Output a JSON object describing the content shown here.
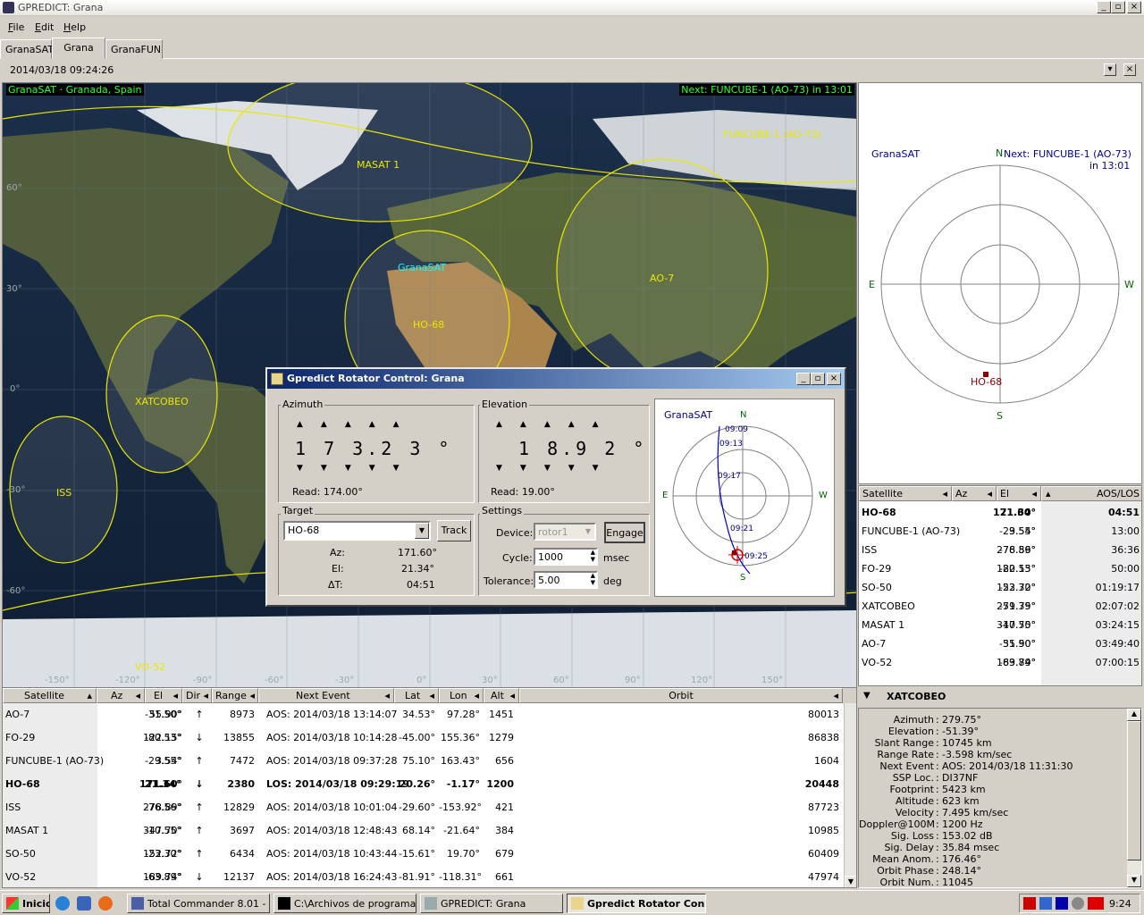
{
  "window": {
    "title": "GPREDICT: Grana"
  },
  "menu": [
    "File",
    "Edit",
    "Help"
  ],
  "tabs": [
    "GranaSAT",
    "Grana",
    "GranaFUN"
  ],
  "datetime": "2014/03/18 09:24:26",
  "map": {
    "ground_station": "GranaSAT · Granada, Spain",
    "next": "Next: FUNCUBE-1 (AO-73) in 13:01",
    "sat_labels": {
      "funcube": "FUNCUBE-1 (AO-73)",
      "masat": "MASAT 1",
      "granasat": "GranaSAT",
      "ao7": "AO-7",
      "ho68": "HO-68",
      "xatcobeo": "XATCOBEO",
      "iss": "ISS",
      "vo52": "VO-52"
    },
    "lat_labels": [
      "60°",
      "30°",
      "0°",
      "-30°",
      "-60°"
    ],
    "lon_labels": [
      "-150°",
      "-120°",
      "-90°",
      "-60°",
      "-30°",
      "0°",
      "30°",
      "60°",
      "90°",
      "120°",
      "150°"
    ]
  },
  "polar": {
    "station": "GranaSAT",
    "next_line1": "Next: FUNCUBE-1 (AO-73)",
    "next_line2": "in 13:01",
    "N": "N",
    "S": "S",
    "E": "E",
    "W": "W",
    "sat": "HO-68"
  },
  "satlist": {
    "headers": [
      "Satellite",
      "Az",
      "El",
      "AOS/LOS"
    ],
    "rows": [
      {
        "name": "HO-68",
        "az": "171.60°",
        "el": "21.34°",
        "t": "04:51"
      },
      {
        "name": "FUNCUBE-1 (AO-73)",
        "az": "3.54°",
        "el": "-29.55°",
        "t": "13:00"
      },
      {
        "name": "ISS",
        "az": "278.89°",
        "el": "-76.56°",
        "t": "36:36"
      },
      {
        "name": "FO-29",
        "az": "122.15°",
        "el": "-80.53°",
        "t": "50:00"
      },
      {
        "name": "SO-50",
        "az": "152.72°",
        "el": "-23.30°",
        "t": "01:19:17"
      },
      {
        "name": "XATCOBEO",
        "az": "279.75°",
        "el": "-51.39°",
        "t": "02:07:02"
      },
      {
        "name": "MASAT 1",
        "az": "347.70°",
        "el": "-10.55°",
        "t": "03:24:15"
      },
      {
        "name": "AO-7",
        "az": "55.90°",
        "el": "-31.50°",
        "t": "03:49:40"
      },
      {
        "name": "VO-52",
        "az": "189.74°",
        "el": "-63.89°",
        "t": "07:00:15"
      }
    ]
  },
  "table": {
    "headers": [
      "Satellite",
      "Az",
      "El",
      "Dir",
      "Range",
      "Next Event",
      "Lat",
      "Lon",
      "Alt",
      "Orbit"
    ],
    "rows": [
      {
        "name": "AO-7",
        "az": "55.90°",
        "el": "-31.50°",
        "dir": "↑",
        "range": "8973",
        "event": "AOS: 2014/03/18 13:14:07",
        "lat": "34.53°",
        "lon": "97.28°",
        "alt": "1451",
        "orbit": "80013"
      },
      {
        "name": "FO-29",
        "az": "122.15°",
        "el": "-80.53°",
        "dir": "↓",
        "range": "13855",
        "event": "AOS: 2014/03/18 10:14:28",
        "lat": "-45.00°",
        "lon": "155.36°",
        "alt": "1279",
        "orbit": "86838"
      },
      {
        "name": "FUNCUBE-1 (AO-73)",
        "az": "3.54°",
        "el": "-29.55°",
        "dir": "↑",
        "range": "7472",
        "event": "AOS: 2014/03/18 09:37:28",
        "lat": "75.10°",
        "lon": "163.43°",
        "alt": "656",
        "orbit": "1604"
      },
      {
        "name": "HO-68",
        "az": "171.60°",
        "el": "21.34°",
        "dir": "↓",
        "range": "2380",
        "event": "LOS: 2014/03/18 09:29:19",
        "lat": "20.26°",
        "lon": "-1.17°",
        "alt": "1200",
        "orbit": "20448"
      },
      {
        "name": "ISS",
        "az": "278.89°",
        "el": "-76.56°",
        "dir": "↑",
        "range": "12829",
        "event": "AOS: 2014/03/18 10:01:04",
        "lat": "-29.60°",
        "lon": "-153.92°",
        "alt": "421",
        "orbit": "87723"
      },
      {
        "name": "MASAT 1",
        "az": "347.70°",
        "el": "-10.55°",
        "dir": "↑",
        "range": "3697",
        "event": "AOS: 2014/03/18 12:48:43",
        "lat": "68.14°",
        "lon": "-21.64°",
        "alt": "384",
        "orbit": "10985"
      },
      {
        "name": "SO-50",
        "az": "152.72°",
        "el": "-23.30°",
        "dir": "↑",
        "range": "6434",
        "event": "AOS: 2014/03/18 10:43:44",
        "lat": "-15.61°",
        "lon": "19.70°",
        "alt": "679",
        "orbit": "60409"
      },
      {
        "name": "VO-52",
        "az": "189.74°",
        "el": "-63.89°",
        "dir": "↓",
        "range": "12137",
        "event": "AOS: 2014/03/18 16:24:43",
        "lat": "-81.91°",
        "lon": "-118.31°",
        "alt": "661",
        "orbit": "47974"
      }
    ]
  },
  "info": {
    "title": "XATCOBEO",
    "fields": [
      {
        "k": "Azimuth",
        "v": "279.75°"
      },
      {
        "k": "Elevation",
        "v": "-51.39°"
      },
      {
        "k": "Slant Range",
        "v": "10745 km"
      },
      {
        "k": "Range Rate",
        "v": "-3.598 km/sec"
      },
      {
        "k": "Next Event",
        "v": "AOS: 2014/03/18 11:31:30"
      },
      {
        "k": "SSP Loc.",
        "v": "DI37NF"
      },
      {
        "k": "Footprint",
        "v": "5423 km"
      },
      {
        "k": "Altitude",
        "v": "623 km"
      },
      {
        "k": "Velocity",
        "v": "7.495 km/sec"
      },
      {
        "k": "Doppler@100M",
        "v": "1200 Hz"
      },
      {
        "k": "Sig. Loss",
        "v": "153.02 dB"
      },
      {
        "k": "Sig. Delay",
        "v": "35.84 msec"
      },
      {
        "k": "Mean Anom.",
        "v": "176.46°"
      },
      {
        "k": "Orbit Phase",
        "v": "248.14°"
      },
      {
        "k": "Orbit Num.",
        "v": "11045"
      }
    ]
  },
  "rotator": {
    "title": "Gpredict Rotator Control: Grana",
    "azimuth_label": "Azimuth",
    "azimuth_digits": "1 7 3.2 3 °",
    "azimuth_read": "Read:    174.00°",
    "elevation_label": "Elevation",
    "elevation_digits": "1 8.9 2 °",
    "elevation_read": "Read:    19.00°",
    "target_label": "Target",
    "target_value": "HO-68",
    "track_button": "Track",
    "az_label": "Az:",
    "az_value": "171.60°",
    "el_label": "El:",
    "el_value": "21.34°",
    "dt_label": "ΔT:",
    "dt_value": "04:51",
    "settings_label": "Settings",
    "device_label": "Device:",
    "device_value": "rotor1",
    "engage_button": "Engage",
    "cycle_label": "Cycle:",
    "cycle_value": "1000",
    "cycle_unit": "msec",
    "tol_label": "Tolerance:",
    "tol_value": "5.00",
    "tol_unit": "deg",
    "polar_station": "GranaSAT",
    "N": "N",
    "S": "S",
    "E": "E",
    "W": "W",
    "times": [
      "09:09",
      "09:13",
      "09:17",
      "09:21",
      "09:25"
    ]
  },
  "taskbar": {
    "start": "Inicio",
    "tasks": [
      "Total Commander 8.01 - ...",
      "C:\\Archivos de programa...",
      "GPREDICT: Grana",
      "Gpredict Rotator Con..."
    ],
    "clock": "9:24"
  }
}
